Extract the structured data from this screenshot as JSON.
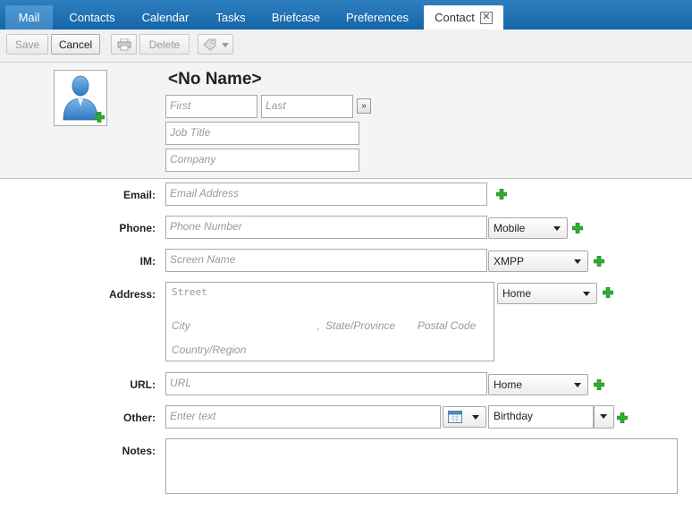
{
  "tabs": {
    "mail": "Mail",
    "contacts": "Contacts",
    "calendar": "Calendar",
    "tasks": "Tasks",
    "briefcase": "Briefcase",
    "preferences": "Preferences",
    "contact": "Contact",
    "close_glyph": "✕"
  },
  "toolbar": {
    "save": "Save",
    "cancel": "Cancel",
    "delete": "Delete",
    "print_icon": "printer-icon",
    "tag_icon": "tag-icon"
  },
  "header": {
    "name": "<No Name>",
    "first_placeholder": "First",
    "last_placeholder": "Last",
    "more_glyph": "»",
    "job_title_placeholder": "Job Title",
    "company_placeholder": "Company"
  },
  "form": {
    "email_label": "Email:",
    "email_placeholder": "Email Address",
    "phone_label": "Phone:",
    "phone_placeholder": "Phone Number",
    "phone_type": "Mobile",
    "im_label": "IM:",
    "im_placeholder": "Screen Name",
    "im_type": "XMPP",
    "address_label": "Address:",
    "street_placeholder": "Street",
    "city_placeholder": "City",
    "comma": ",",
    "state_placeholder": "State/Province",
    "postal_placeholder": "Postal Code",
    "country_placeholder": "Country/Region",
    "address_type": "Home",
    "url_label": "URL:",
    "url_placeholder": "URL",
    "url_type": "Home",
    "other_label": "Other:",
    "other_placeholder": "Enter text",
    "other_type": "Birthday",
    "notes_label": "Notes:"
  },
  "colors": {
    "tabbar": "#1a6aad",
    "plus": "#2eae2e"
  }
}
